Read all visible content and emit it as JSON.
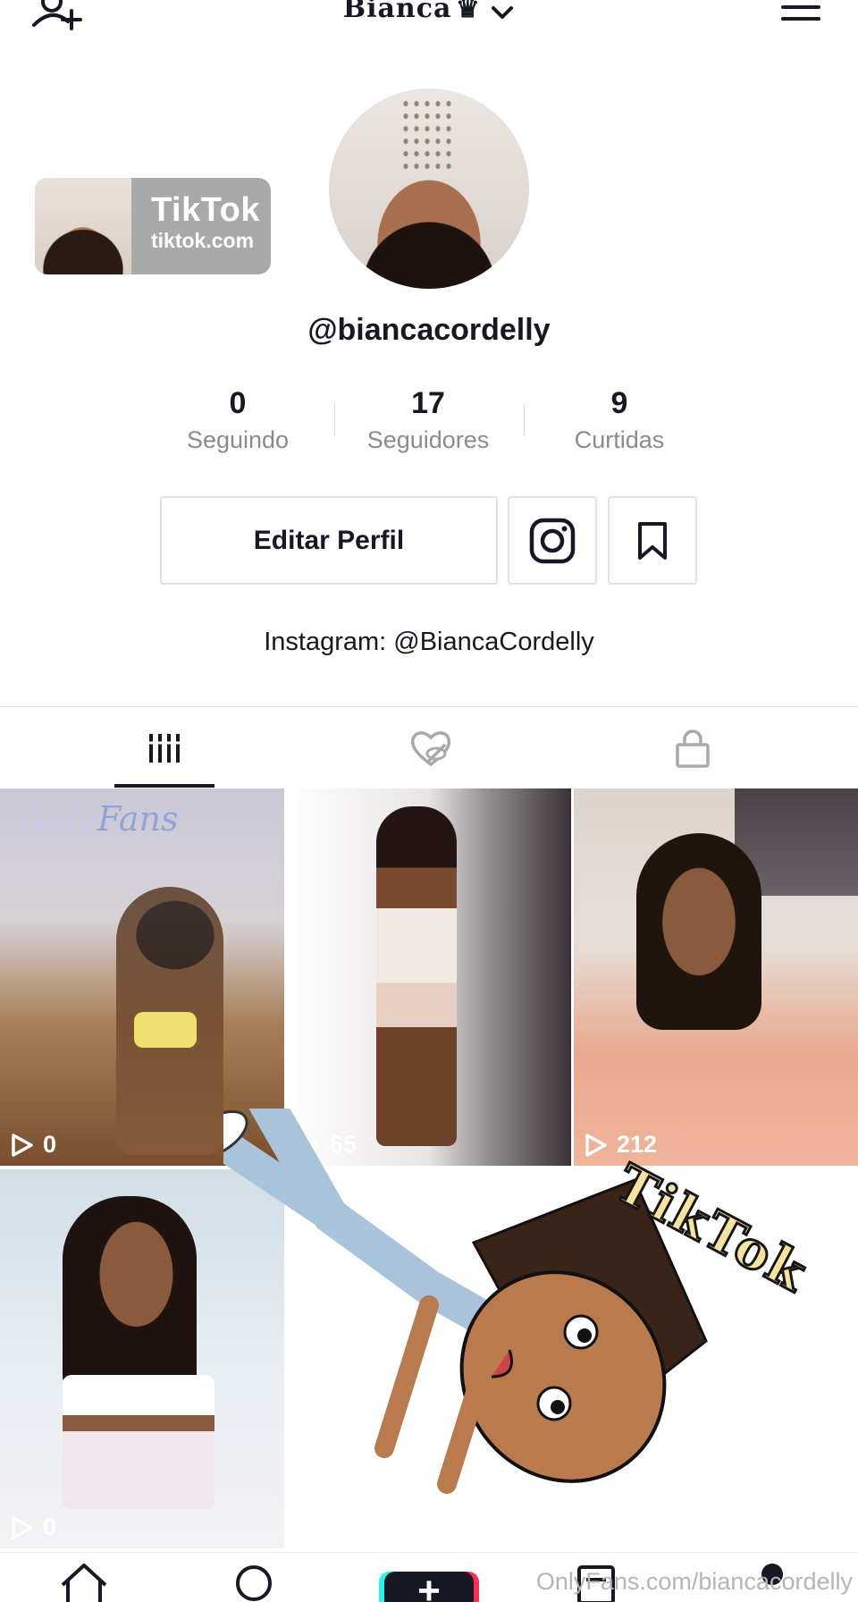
{
  "header": {
    "title": "Bianca",
    "crown": "♛"
  },
  "badge": {
    "name": "TikTok",
    "url": "tiktok.com"
  },
  "profile": {
    "handle": "@biancacordelly",
    "bio": "Instagram: @BiancaCordelly"
  },
  "stats": [
    {
      "value": "0",
      "label": "Seguindo"
    },
    {
      "value": "17",
      "label": "Seguidores"
    },
    {
      "value": "9",
      "label": "Curtidas"
    }
  ],
  "actions": {
    "edit_profile": "Editar Perfil"
  },
  "tabs": [
    {
      "icon": "grid-videos-icon",
      "active": true
    },
    {
      "icon": "liked-hidden-icon",
      "active": false
    },
    {
      "icon": "lock-icon",
      "active": false
    }
  ],
  "videos": [
    {
      "views": "0",
      "watermark": "Only",
      "watermark_script": "Fans"
    },
    {
      "views": "65"
    },
    {
      "views": "212"
    },
    {
      "views": "0"
    }
  ],
  "sticker_text": "TikTok",
  "footer_watermark": "OnlyFans.com/biancacordelly",
  "create_label": "+"
}
